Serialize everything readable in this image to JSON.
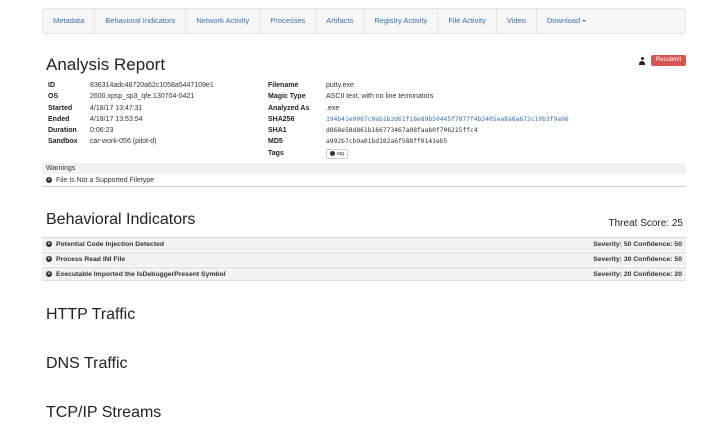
{
  "nav": [
    "Metadata",
    "Behavioral Indicators",
    "Network Activity",
    "Processes",
    "Artifacts",
    "Registry Activity",
    "File Activity",
    "Video",
    "Download"
  ],
  "title": "Analysis Report",
  "resubmit": "Resubmit",
  "left": [
    {
      "k": "ID",
      "v": "836314adc48720a62c1058a5447109e1"
    },
    {
      "k": "OS",
      "v": "2600.xpsp_sp3_qfe.130704-0421"
    },
    {
      "k": "Started",
      "v": "4/18/17 13:47:31"
    },
    {
      "k": "Ended",
      "v": "4/18/17 13:53:54"
    },
    {
      "k": "Duration",
      "v": "0:06:23"
    },
    {
      "k": "Sandbox",
      "v": "car-work-056 (pilot-d)"
    }
  ],
  "right": {
    "filename_label": "Filename",
    "filename": "putty.exe",
    "magic_label": "Magic Type",
    "magic": "ASCII text, with no line terminators",
    "analyzed_label": "Analyzed As",
    "analyzed": ".exe",
    "sha256_label": "SHA256",
    "sha256": "194b41e0067c0ab1b3d61f18e89b50445f7877f4b2405ea8a6a672c10b3f9a96",
    "sha1_label": "SHA1",
    "sha1": "d868e58d861b166773467a08faab0f706215ffc4",
    "md5_label": "MD5",
    "md5": "a992b7cb9a01bd182a6f588ff0141eb5",
    "tags_label": "Tags",
    "tag_button": "tag"
  },
  "warnings": {
    "title": "Warnings",
    "items": [
      "File Is Not a Supported Filetype"
    ]
  },
  "behavioral": {
    "title": "Behavioral Indicators",
    "threat_score": "Threat Score: 25",
    "items": [
      {
        "name": "Potential Code Injection Detected",
        "score": "Severity: 50 Confidence: 50"
      },
      {
        "name": "Process Read INI File",
        "score": "Severity: 30 Confidence: 50"
      },
      {
        "name": "Executable Imported the IsDebuggerPresent Symbol",
        "score": "Severity: 20 Confidence: 20"
      }
    ]
  },
  "sections": [
    "HTTP Traffic",
    "DNS Traffic",
    "TCP/IP Streams"
  ]
}
